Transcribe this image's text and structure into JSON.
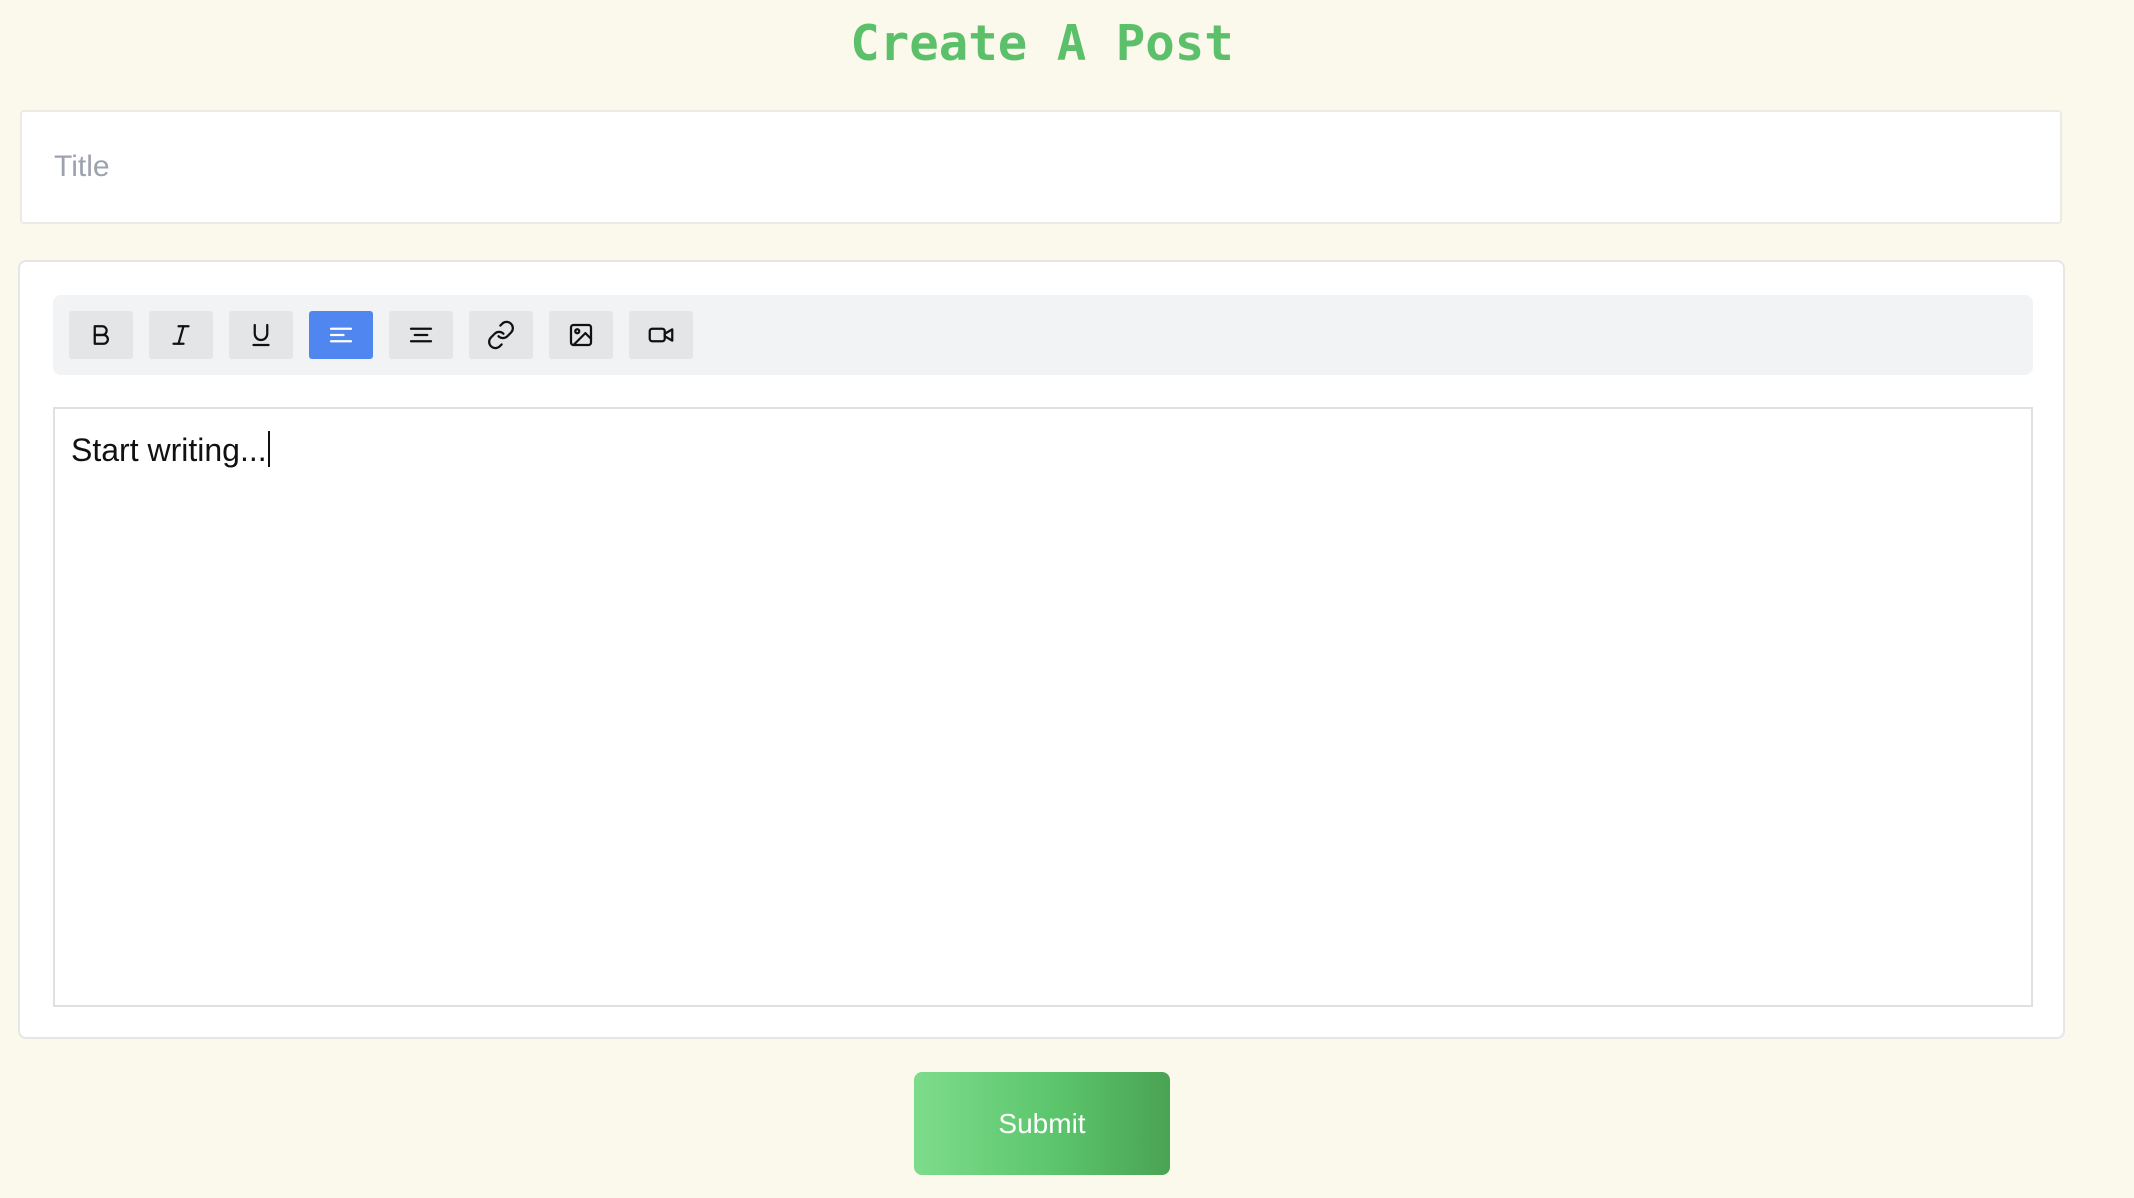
{
  "page": {
    "title": "Create A Post"
  },
  "title_field": {
    "placeholder": "Title",
    "value": ""
  },
  "toolbar": {
    "buttons": [
      {
        "name": "bold",
        "icon": "bold-icon",
        "active": false
      },
      {
        "name": "italic",
        "icon": "italic-icon",
        "active": false
      },
      {
        "name": "underline",
        "icon": "underline-icon",
        "active": false
      },
      {
        "name": "align-left",
        "icon": "align-left-icon",
        "active": true
      },
      {
        "name": "align-center",
        "icon": "align-center-icon",
        "active": false
      },
      {
        "name": "link",
        "icon": "link-icon",
        "active": false
      },
      {
        "name": "image",
        "icon": "image-icon",
        "active": false
      },
      {
        "name": "video",
        "icon": "video-icon",
        "active": false
      }
    ]
  },
  "editor": {
    "content": "Start writing..."
  },
  "submit": {
    "label": "Submit"
  },
  "colors": {
    "background": "#fbf9ec",
    "title_green": "#5cc06a",
    "active_blue": "#4f86f0",
    "submit_gradient_start": "#7ddc8b",
    "submit_gradient_end": "#49a353"
  }
}
